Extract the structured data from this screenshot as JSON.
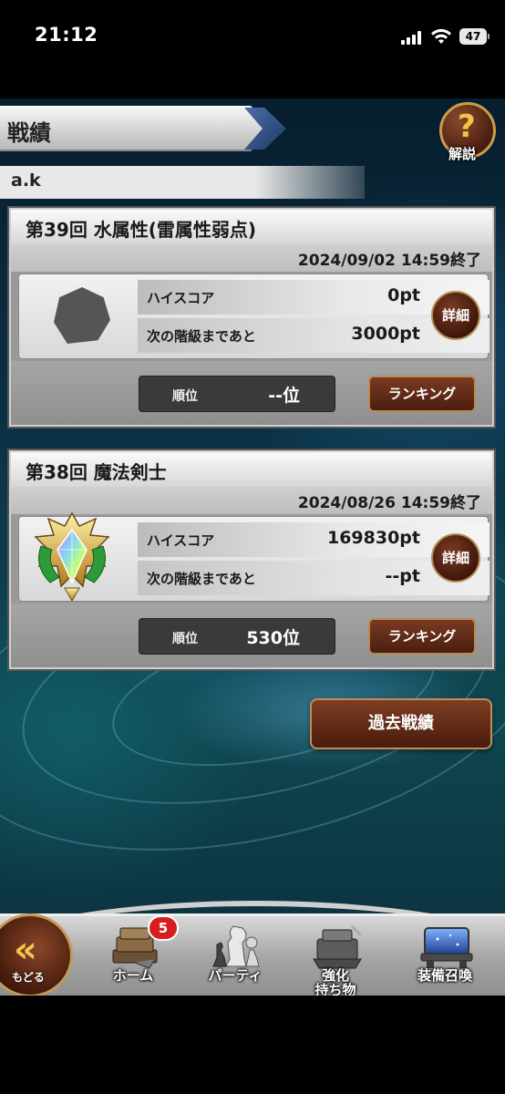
{
  "status_bar": {
    "time": "21:12",
    "battery": "47"
  },
  "header": {
    "title": "戦績",
    "help_symbol": "?",
    "help_label": "解説"
  },
  "user": {
    "name": "a.k"
  },
  "events": [
    {
      "title": "第39回  水属性(雷属性弱点)",
      "end_date": "2024/09/02  14:59終了",
      "high_score_label": "ハイスコア",
      "high_score": "0pt",
      "next_rank_label": "次の階級まであと",
      "next_rank": "3000pt",
      "detail_label": "詳細",
      "rank_label": "順位",
      "rank_value": "--位",
      "ranking_label": "ランキング"
    },
    {
      "title": "第38回  魔法剣士",
      "end_date": "2024/08/26  14:59終了",
      "high_score_label": "ハイスコア",
      "high_score": "169830pt",
      "next_rank_label": "次の階級まであと",
      "next_rank": "--pt",
      "detail_label": "詳細",
      "rank_label": "順位",
      "rank_value": "530位",
      "ranking_label": "ランキング"
    }
  ],
  "past_records_label": "過去戦績",
  "nav": {
    "back_label": "もどる",
    "home_label": "ホーム",
    "home_badge": "5",
    "party_label": "パーティ",
    "enhance_label_1": "強化",
    "enhance_label_2": "持ち物",
    "summon_label": "装備召喚"
  },
  "icons": [
    "signal-icon",
    "wifi-icon",
    "battery-icon",
    "help-icon",
    "rank-emblem-icon",
    "back-chevron-icon",
    "home-icon",
    "party-icon",
    "enhance-icon",
    "summon-icon"
  ]
}
